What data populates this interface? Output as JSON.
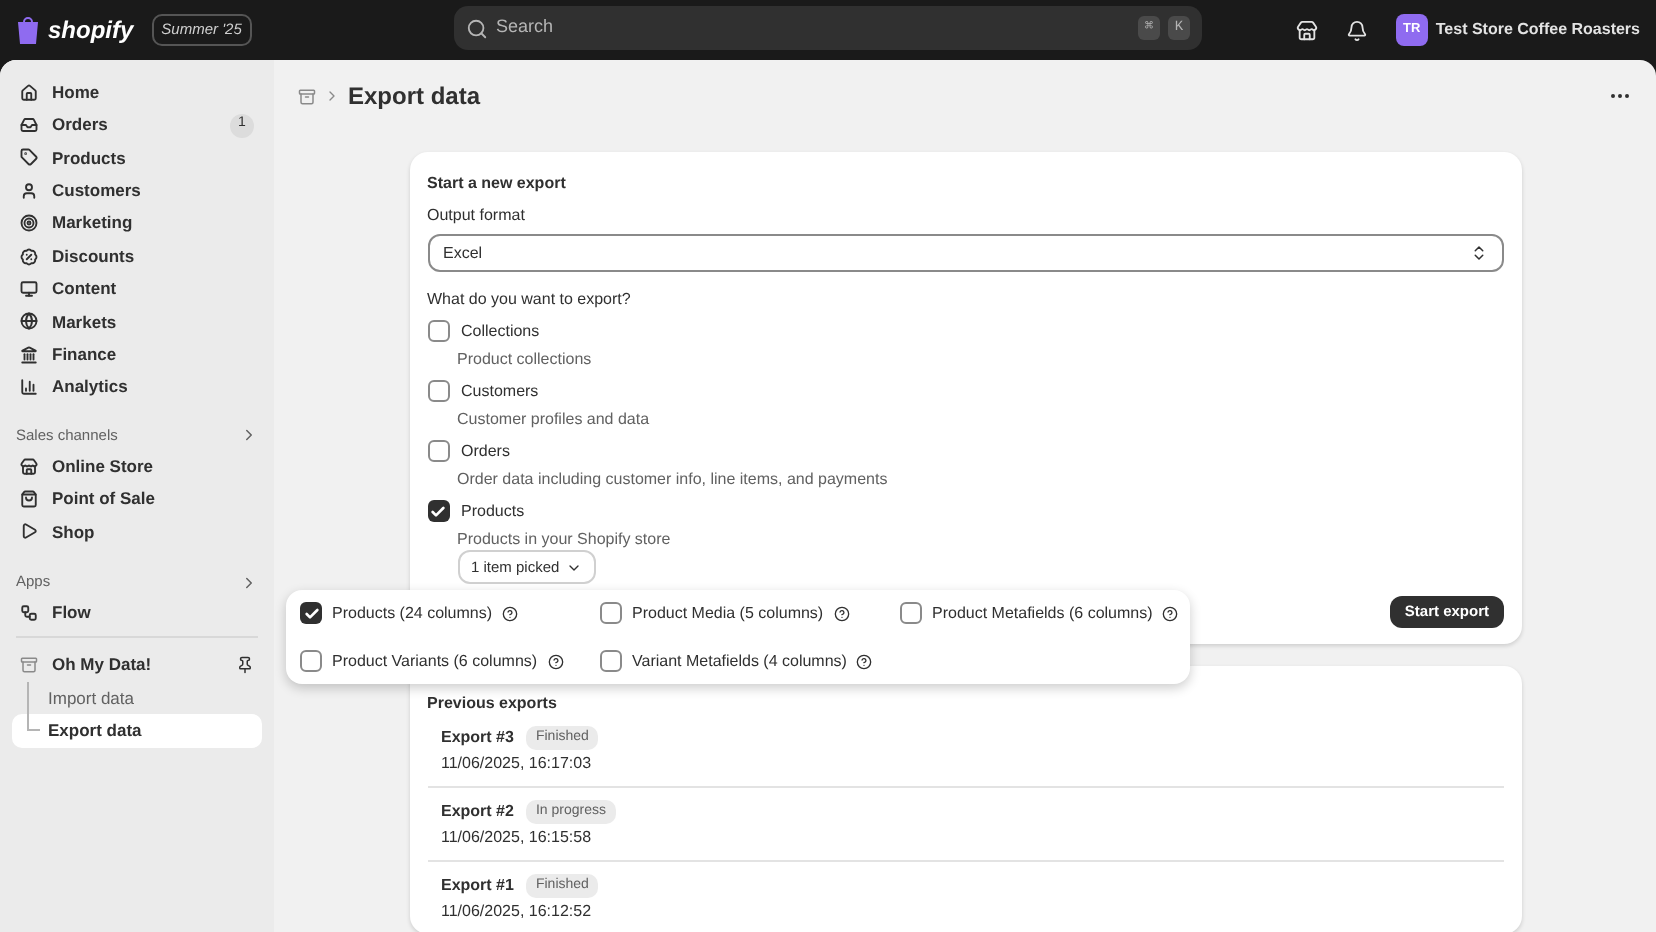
{
  "topbar": {
    "logo": "shopify",
    "edition": "Summer '25",
    "search": {
      "placeholder": "Search"
    },
    "shortcut_keys": [
      "⌘",
      "K"
    ],
    "store": {
      "initials": "TR",
      "name": "Test Store Coffee Roasters"
    }
  },
  "sidebar": {
    "items": [
      {
        "label": "Home",
        "selected": false
      },
      {
        "label": "Orders",
        "selected": false,
        "badge": "1"
      },
      {
        "label": "Products",
        "selected": false
      },
      {
        "label": "Customers",
        "selected": false
      },
      {
        "label": "Marketing",
        "selected": false
      },
      {
        "label": "Discounts",
        "selected": false
      },
      {
        "label": "Content",
        "selected": false
      },
      {
        "label": "Markets",
        "selected": false
      },
      {
        "label": "Finance",
        "selected": false
      },
      {
        "label": "Analytics",
        "selected": false
      }
    ],
    "sales_channels": {
      "title": "Sales channels",
      "items": [
        {
          "label": "Online Store"
        },
        {
          "label": "Point of Sale"
        },
        {
          "label": "Shop"
        }
      ]
    },
    "apps": {
      "title": "Apps",
      "items": [
        {
          "label": "Flow"
        }
      ]
    },
    "app": {
      "label": "Oh My Data!",
      "children": [
        {
          "label": "Import data",
          "selected": false
        },
        {
          "label": "Export data",
          "selected": true
        }
      ]
    }
  },
  "page": {
    "title": "Export data"
  },
  "export_card": {
    "title": "Start a new export",
    "format_label": "Output format",
    "format_value": "Excel",
    "question": "What do you want to export?",
    "options": [
      {
        "label": "Collections",
        "description": "Product collections",
        "checked": false
      },
      {
        "label": "Customers",
        "description": "Customer profiles and data",
        "checked": false
      },
      {
        "label": "Orders",
        "description": "Order data including customer info, line items, and payments",
        "checked": false
      },
      {
        "label": "Products",
        "description": "Products in your Shopify store",
        "checked": true
      }
    ],
    "picker": "1 item picked",
    "start_button": "Start export"
  },
  "column_popover": {
    "options": [
      {
        "label": "Products (24 columns)",
        "checked": true
      },
      {
        "label": "Product Media (5 columns)",
        "checked": false
      },
      {
        "label": "Product Metafields (6 columns)",
        "checked": false
      },
      {
        "label": "Product Variants (6 columns)",
        "checked": false
      },
      {
        "label": "Variant Metafields (4 columns)",
        "checked": false
      }
    ]
  },
  "previous_exports": {
    "title": "Previous exports",
    "items": [
      {
        "name": "Export #3",
        "status": "Finished",
        "time": "11/06/2025, 16:17:03"
      },
      {
        "name": "Export #2",
        "status": "In progress",
        "time": "11/06/2025, 16:15:58"
      },
      {
        "name": "Export #1",
        "status": "Finished",
        "time": "11/06/2025, 16:12:52"
      }
    ]
  }
}
